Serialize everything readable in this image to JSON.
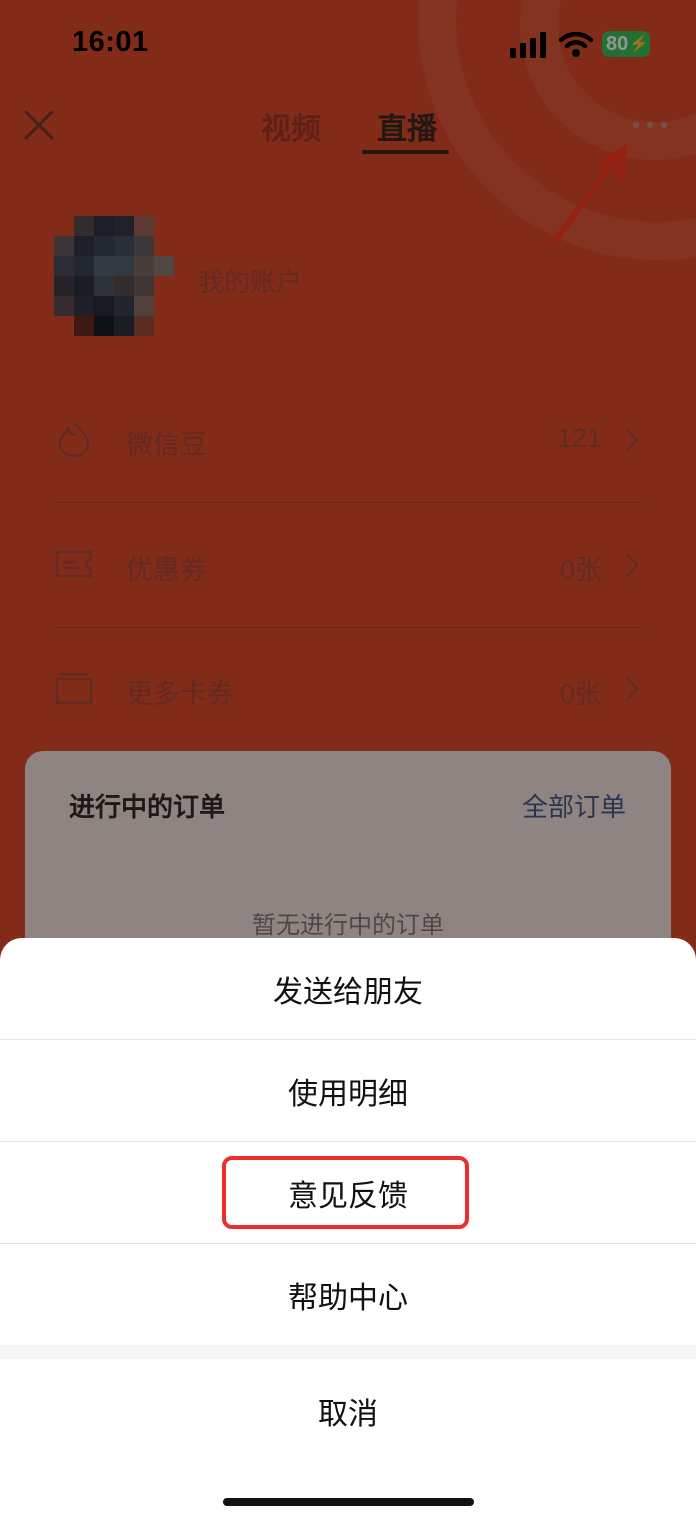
{
  "status_bar": {
    "time": "16:01",
    "battery": "80"
  },
  "nav": {
    "tabs": [
      {
        "label": "视频"
      },
      {
        "label": "直播"
      }
    ]
  },
  "account": {
    "label": "我的账户"
  },
  "rows": [
    {
      "icon": "bean-icon",
      "label": "微信豆",
      "value": "121"
    },
    {
      "icon": "ticket-icon",
      "label": "优惠券",
      "value": "0张"
    },
    {
      "icon": "cards-icon",
      "label": "更多卡券",
      "value": "0张"
    }
  ],
  "orders": {
    "title": "进行中的订单",
    "all_link": "全部订单",
    "empty": "暂无进行中的订单"
  },
  "sheet": {
    "items": [
      {
        "label": "发送给朋友"
      },
      {
        "label": "使用明细"
      },
      {
        "label": "意见反馈"
      },
      {
        "label": "帮助中心"
      }
    ],
    "cancel": "取消"
  },
  "colors": {
    "accent": "#e24a2b",
    "annotation": "#ee2e2e",
    "battery": "#3cc25b"
  }
}
